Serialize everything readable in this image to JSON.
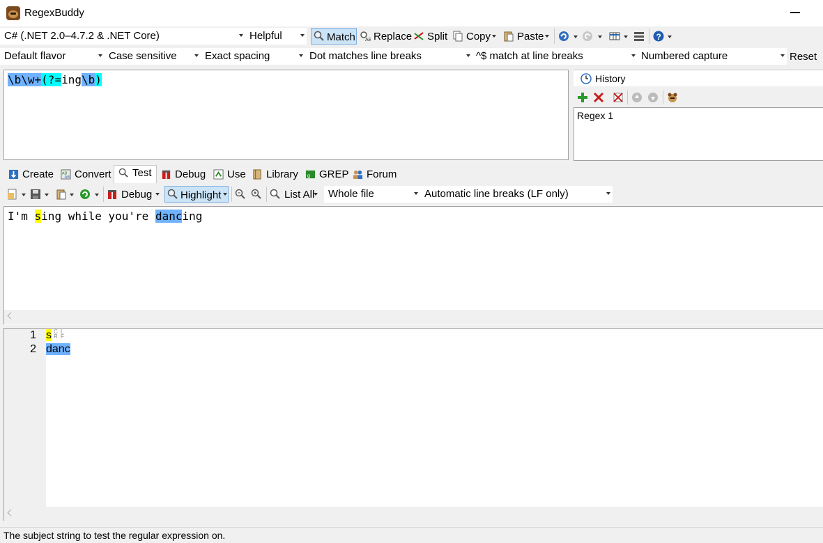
{
  "window": {
    "title": "RegexBuddy"
  },
  "toolbar1": {
    "language": "C# (.NET 2.0–4.7.2 & .NET Core)",
    "helpfulness": "Helpful",
    "match": "Match",
    "replace": "Replace",
    "split": "Split",
    "copy": "Copy",
    "paste": "Paste"
  },
  "toolbar2": {
    "flavor": "Default flavor",
    "case": "Case sensitive",
    "spacing": "Exact spacing",
    "dot": "Dot matches line breaks",
    "anchors": "^$ match at line breaks",
    "capture": "Numbered capture",
    "reset": "Reset"
  },
  "regex": {
    "parts": [
      "\\b",
      "\\w+",
      "(?=",
      "ing",
      "\\b",
      ")"
    ]
  },
  "history": {
    "title": "History",
    "items": [
      "Regex 1"
    ]
  },
  "tabs": [
    "Create",
    "Convert",
    "Test",
    "Debug",
    "Use",
    "Library",
    "GREP",
    "Forum"
  ],
  "test_toolbar": {
    "debug": "Debug",
    "highlight": "Highlight",
    "list_all": "List All",
    "scope": "Whole file",
    "line_breaks": "Automatic line breaks (LF only)"
  },
  "subject": {
    "seg1": "I'm ",
    "m1": "s",
    "seg2": "ing while you're ",
    "m2": "danc",
    "seg3": "ing"
  },
  "results": [
    {
      "num": "1",
      "text": "s"
    },
    {
      "num": "2",
      "text": "danc"
    }
  ],
  "status": "The subject string to test the regular expression on."
}
